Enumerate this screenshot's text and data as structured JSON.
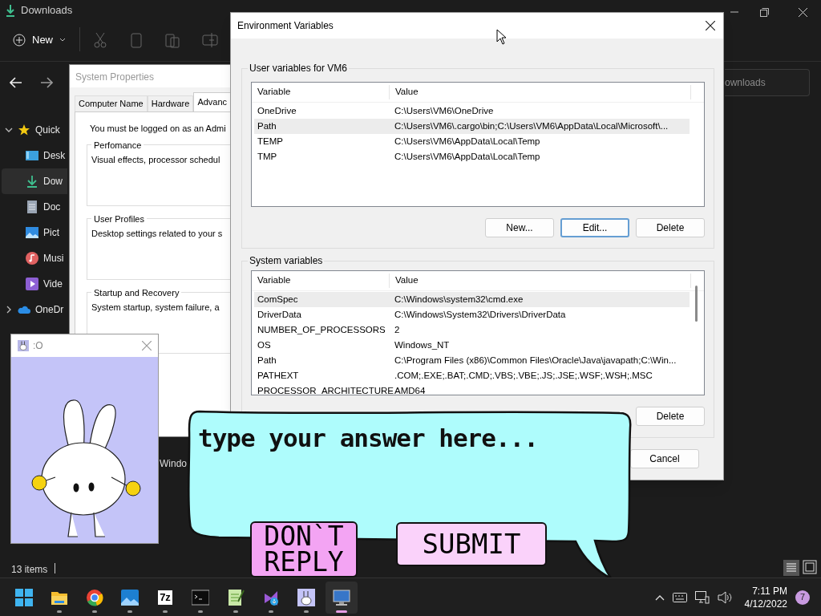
{
  "explorer": {
    "title": "Downloads",
    "new_button": "New",
    "search_placeholder": "ownloads",
    "status": "13 items",
    "nav": [
      {
        "label": "Quick",
        "kind": "star",
        "selected": false,
        "expanded": true,
        "children": [
          {
            "label": "Desk",
            "kind": "desktop",
            "selected": false
          },
          {
            "label": "Dow",
            "kind": "download",
            "selected": true
          },
          {
            "label": "Doc",
            "kind": "document",
            "selected": false
          },
          {
            "label": "Pict",
            "kind": "picture",
            "selected": false
          },
          {
            "label": "Musi",
            "kind": "music",
            "selected": false
          },
          {
            "label": "Vide",
            "kind": "video",
            "selected": false
          }
        ]
      },
      {
        "label": "OneDr",
        "kind": "cloud",
        "selected": false,
        "expanded": false
      }
    ],
    "behind_text": "Windo"
  },
  "system_properties": {
    "title": "System Properties",
    "tabs": [
      {
        "label": "Computer Name",
        "selected": false
      },
      {
        "label": "Hardware",
        "selected": false
      },
      {
        "label": "Advanc",
        "selected": true
      }
    ],
    "notice": "You must be logged on as an Admi",
    "groups": [
      {
        "title": "Perfomance",
        "text": "Visual effects, processor schedul"
      },
      {
        "title": "User Profiles",
        "text": "Desktop settings related to your s"
      },
      {
        "title": "Startup and Recovery",
        "text": "System startup, system failure, a"
      }
    ]
  },
  "environment_variables": {
    "title": "Environment Variables",
    "user_variables": {
      "title": "User variables for VM6",
      "columns": [
        "Variable",
        "Value"
      ],
      "rows": [
        {
          "variable": "OneDrive",
          "value": "C:\\Users\\VM6\\OneDrive",
          "selected": false
        },
        {
          "variable": "Path",
          "value": "C:\\Users\\VM6\\.cargo\\bin;C:\\Users\\VM6\\AppData\\Local\\Microsoft\\...",
          "selected": true
        },
        {
          "variable": "TEMP",
          "value": "C:\\Users\\VM6\\AppData\\Local\\Temp",
          "selected": false
        },
        {
          "variable": "TMP",
          "value": "C:\\Users\\VM6\\AppData\\Local\\Temp",
          "selected": false
        }
      ],
      "buttons": [
        {
          "label": "New...",
          "focused": false
        },
        {
          "label": "Edit...",
          "focused": true
        },
        {
          "label": "Delete",
          "focused": false
        }
      ]
    },
    "system_variables": {
      "title": "System variables",
      "columns": [
        "Variable",
        "Value"
      ],
      "rows": [
        {
          "variable": "ComSpec",
          "value": "C:\\Windows\\system32\\cmd.exe",
          "selected": true
        },
        {
          "variable": "DriverData",
          "value": "C:\\Windows\\System32\\Drivers\\DriverData",
          "selected": false
        },
        {
          "variable": "NUMBER_OF_PROCESSORS",
          "value": "2",
          "selected": false
        },
        {
          "variable": "OS",
          "value": "Windows_NT",
          "selected": false
        },
        {
          "variable": "Path",
          "value": "C:\\Program Files (x86)\\Common Files\\Oracle\\Java\\javapath;C:\\Win...",
          "selected": false
        },
        {
          "variable": "PATHEXT",
          "value": ".COM;.EXE;.BAT;.CMD;.VBS;.VBE;.JS;.JSE;.WSF;.WSH;.MSC",
          "selected": false
        },
        {
          "variable": "PROCESSOR_ARCHITECTURE",
          "value": "AMD64",
          "selected": false
        }
      ],
      "delete_button": "Delete"
    },
    "cancel_button": "Cancel"
  },
  "pet_window": {
    "title": ":O"
  },
  "prompt": {
    "placeholder": "type your answer here...",
    "buttons": [
      "DON`T REPLY",
      "SUBMIT"
    ]
  },
  "taskbar": {
    "apps": [
      {
        "kind": "start",
        "selected": false,
        "running": false
      },
      {
        "kind": "folder",
        "selected": false,
        "running": true
      },
      {
        "kind": "browser",
        "selected": false,
        "running": true
      },
      {
        "kind": "photos",
        "selected": false,
        "running": true
      },
      {
        "kind": "archive",
        "label": "7z",
        "selected": false,
        "running": true
      },
      {
        "kind": "terminal",
        "selected": false,
        "running": true
      },
      {
        "kind": "notepad",
        "selected": false,
        "running": true
      },
      {
        "kind": "installer",
        "selected": false,
        "running": true
      },
      {
        "kind": "bunny",
        "selected": false,
        "running": true
      },
      {
        "kind": "remote",
        "selected": true,
        "running": true
      }
    ],
    "time": "7:11 PM",
    "date": "4/12/2022",
    "notification_count": "7"
  }
}
